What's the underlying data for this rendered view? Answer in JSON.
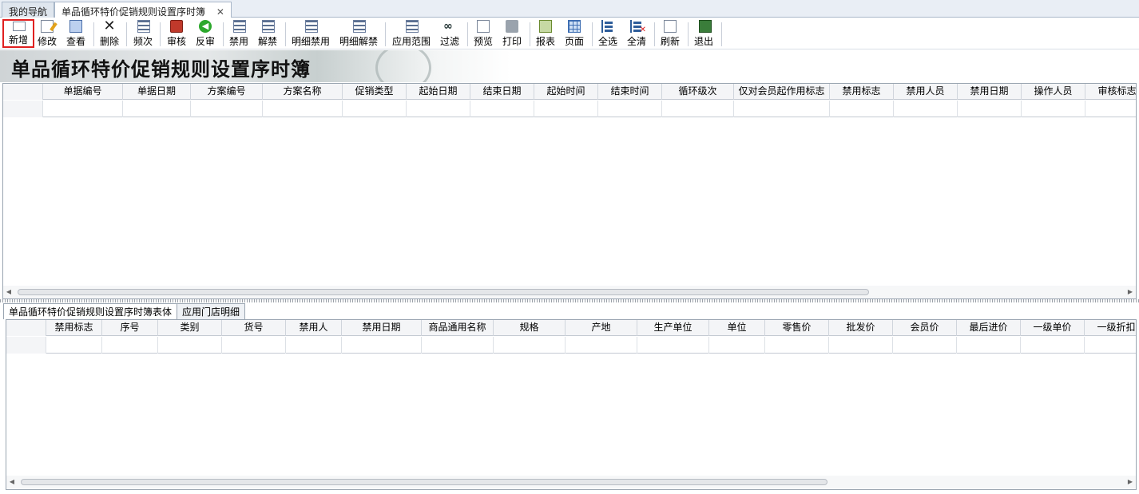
{
  "tabs": [
    {
      "label": "我的导航"
    },
    {
      "label": "单品循环特价促销规则设置序时簿",
      "close": "✕"
    }
  ],
  "toolbar": {
    "buttons": [
      {
        "label": "新增",
        "icon": "new-document-icon"
      },
      {
        "label": "修改",
        "icon": "edit-icon"
      },
      {
        "label": "查看",
        "icon": "view-icon"
      },
      {
        "label": "删除",
        "icon": "delete-icon"
      },
      {
        "label": "频次",
        "icon": "list-icon"
      },
      {
        "label": "审核",
        "icon": "audit-icon"
      },
      {
        "label": "反审",
        "icon": "unaudit-icon"
      },
      {
        "label": "禁用",
        "icon": "list-icon"
      },
      {
        "label": "解禁",
        "icon": "list-icon"
      },
      {
        "label": "明细禁用",
        "icon": "list-icon"
      },
      {
        "label": "明细解禁",
        "icon": "list-icon"
      },
      {
        "label": "应用范围",
        "icon": "list-icon"
      },
      {
        "label": "过滤",
        "icon": "binoculars-icon"
      },
      {
        "label": "预览",
        "icon": "preview-icon"
      },
      {
        "label": "打印",
        "icon": "printer-icon"
      },
      {
        "label": "报表",
        "icon": "report-icon"
      },
      {
        "label": "页面",
        "icon": "page-icon"
      },
      {
        "label": "全选",
        "icon": "select-all-icon"
      },
      {
        "label": "全清",
        "icon": "clear-all-icon"
      },
      {
        "label": "刷新",
        "icon": "refresh-icon"
      },
      {
        "label": "退出",
        "icon": "exit-icon"
      }
    ]
  },
  "banner": {
    "title": "单品循环特价促销规则设置序时簿"
  },
  "main_grid": {
    "columns": [
      "单据编号",
      "单据日期",
      "方案编号",
      "方案名称",
      "促销类型",
      "起始日期",
      "结束日期",
      "起始时间",
      "结束时间",
      "循环级次",
      "仅对会员起作用标志",
      "禁用标志",
      "禁用人员",
      "禁用日期",
      "操作人员",
      "审核标志"
    ]
  },
  "bottom_tabs": [
    {
      "label": "单品循环特价促销规则设置序时簿表体"
    },
    {
      "label": "应用门店明细"
    }
  ],
  "detail_grid": {
    "columns": [
      "禁用标志",
      "序号",
      "类别",
      "货号",
      "禁用人",
      "禁用日期",
      "商品通用名称",
      "规格",
      "产地",
      "生产单位",
      "单位",
      "零售价",
      "批发价",
      "会员价",
      "最后进价",
      "一级单价",
      "一级折扣"
    ]
  },
  "scroll": {
    "left_arrow": "◀",
    "right_arrow": "▶"
  }
}
